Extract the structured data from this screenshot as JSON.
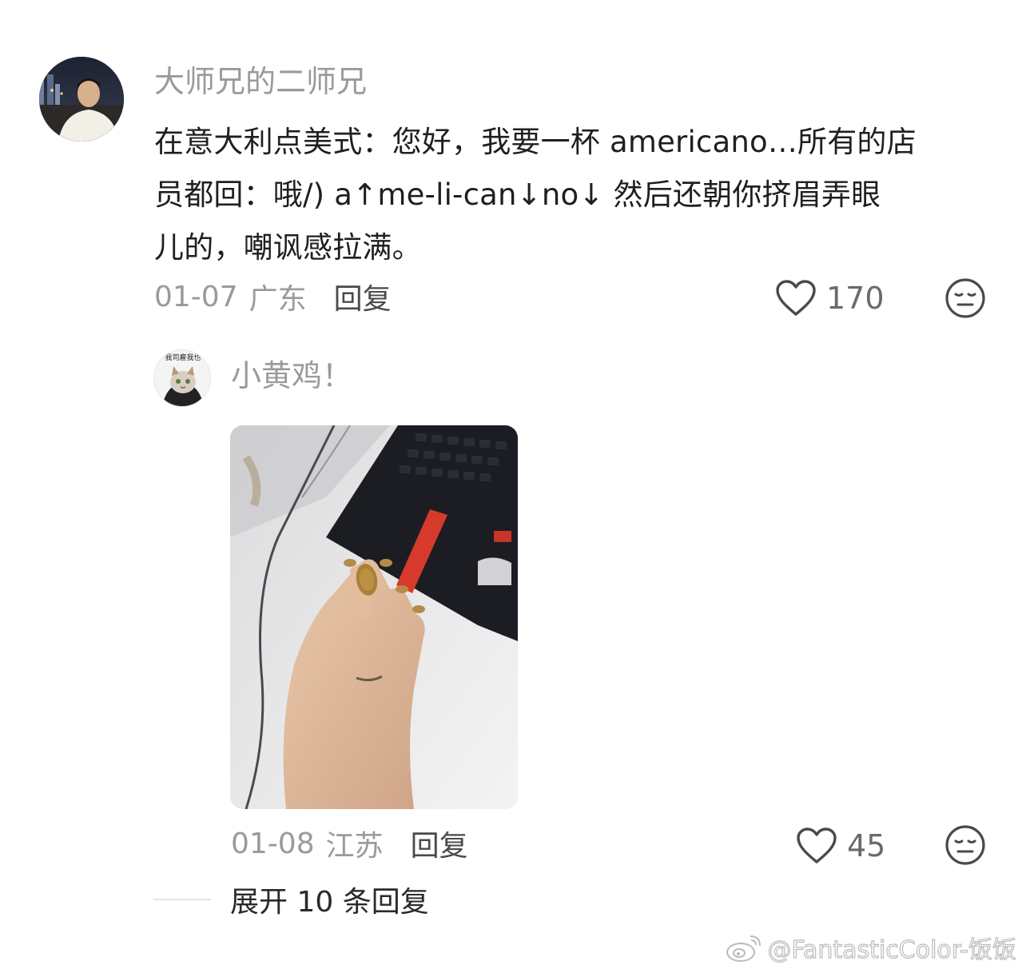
{
  "main_comment": {
    "username": "大师兄的二师兄",
    "text_lines": [
      "在意大利点美式：您好，我要一杯 americano…所有的店",
      "员都回：哦/) a↑me-li-can↓no↓  然后还朝你挤眉弄眼",
      "儿的，嘲讽感拉满。"
    ],
    "date": "01-07",
    "location": "广东",
    "reply_label": "回复",
    "like_count": "170",
    "like_icon": "heart-outline-icon",
    "reaction_icon": "neutral-face-icon"
  },
  "reply_comment": {
    "username": "小黄鸡！",
    "avatar_text": "我司雇我也",
    "photo_description_icon": "photo-thumbnail",
    "date": "01-08",
    "location": "江苏",
    "reply_label": "回复",
    "like_count": "45",
    "like_icon": "heart-outline-icon",
    "reaction_icon": "neutral-face-icon"
  },
  "expand_replies": {
    "label": "展开 10 条回复"
  },
  "watermark": {
    "text": "@FantasticColor-饭饭",
    "icon": "weibo-logo-icon"
  },
  "colors": {
    "username": "#9a9a9a",
    "body_text": "#1f1f1f",
    "meta": "#9a9a9a",
    "icon_stroke": "#4a4a4a"
  }
}
